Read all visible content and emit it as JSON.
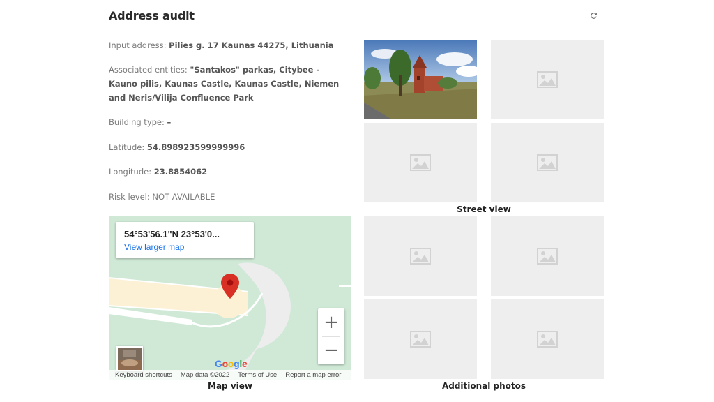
{
  "title": "Address audit",
  "info": {
    "input_address_label": "Input address: ",
    "input_address_value": "Pilies g. 17 Kaunas 44275, Lithuania",
    "entities_label": "Associated entities: ",
    "entities_value": "\"Santakos\" parkas, Citybee - Kauno pilis, Kaunas Castle, Kaunas Castle, Niemen and Neris/Vilija Confluence Park",
    "building_label": "Building type: ",
    "building_value": "–",
    "latitude_label": "Latitude: ",
    "latitude_value": "54.898923599999996",
    "longitude_label": "Longitude: ",
    "longitude_value": "23.8854062",
    "risk_label": "Risk level: ",
    "risk_value": "NOT AVAILABLE"
  },
  "map": {
    "coords": "54°53'56.1\"N 23°53'0...",
    "view_larger": "View larger map",
    "zoom_in": "+",
    "zoom_out": "−",
    "google_letters": [
      "G",
      "o",
      "o",
      "g",
      "l",
      "e"
    ],
    "google_colors": [
      "#4285F4",
      "#EA4335",
      "#FBBC05",
      "#4285F4",
      "#34A853",
      "#EA4335"
    ],
    "footer": [
      "Keyboard shortcuts",
      "Map data ©2022",
      "Terms of Use",
      "Report a map error"
    ],
    "pin_color": "#d93025"
  },
  "captions": {
    "map": "Map view",
    "street": "Street view",
    "additional": "Additional photos"
  },
  "photo_placeholder_icon": "image-placeholder-icon"
}
